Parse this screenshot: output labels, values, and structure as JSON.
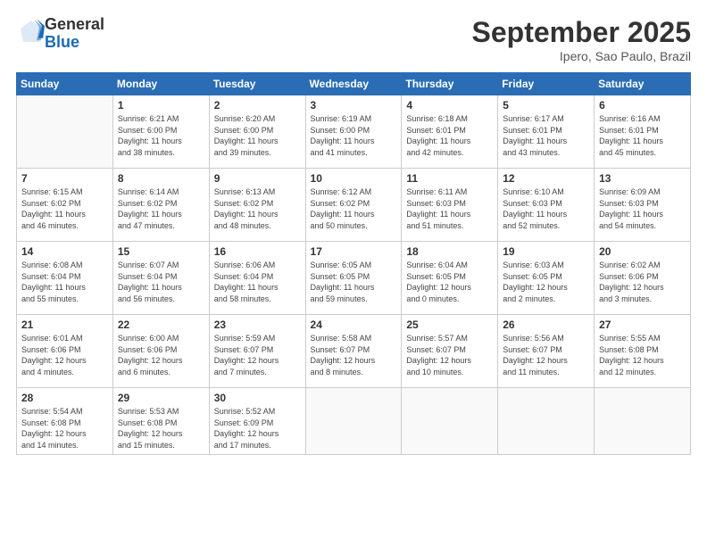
{
  "header": {
    "logo_line1": "General",
    "logo_line2": "Blue",
    "month": "September 2025",
    "location": "Ipero, Sao Paulo, Brazil"
  },
  "days_of_week": [
    "Sunday",
    "Monday",
    "Tuesday",
    "Wednesday",
    "Thursday",
    "Friday",
    "Saturday"
  ],
  "weeks": [
    [
      {
        "day": "",
        "info": ""
      },
      {
        "day": "1",
        "info": "Sunrise: 6:21 AM\nSunset: 6:00 PM\nDaylight: 11 hours\nand 38 minutes."
      },
      {
        "day": "2",
        "info": "Sunrise: 6:20 AM\nSunset: 6:00 PM\nDaylight: 11 hours\nand 39 minutes."
      },
      {
        "day": "3",
        "info": "Sunrise: 6:19 AM\nSunset: 6:00 PM\nDaylight: 11 hours\nand 41 minutes."
      },
      {
        "day": "4",
        "info": "Sunrise: 6:18 AM\nSunset: 6:01 PM\nDaylight: 11 hours\nand 42 minutes."
      },
      {
        "day": "5",
        "info": "Sunrise: 6:17 AM\nSunset: 6:01 PM\nDaylight: 11 hours\nand 43 minutes."
      },
      {
        "day": "6",
        "info": "Sunrise: 6:16 AM\nSunset: 6:01 PM\nDaylight: 11 hours\nand 45 minutes."
      }
    ],
    [
      {
        "day": "7",
        "info": "Sunrise: 6:15 AM\nSunset: 6:02 PM\nDaylight: 11 hours\nand 46 minutes."
      },
      {
        "day": "8",
        "info": "Sunrise: 6:14 AM\nSunset: 6:02 PM\nDaylight: 11 hours\nand 47 minutes."
      },
      {
        "day": "9",
        "info": "Sunrise: 6:13 AM\nSunset: 6:02 PM\nDaylight: 11 hours\nand 48 minutes."
      },
      {
        "day": "10",
        "info": "Sunrise: 6:12 AM\nSunset: 6:02 PM\nDaylight: 11 hours\nand 50 minutes."
      },
      {
        "day": "11",
        "info": "Sunrise: 6:11 AM\nSunset: 6:03 PM\nDaylight: 11 hours\nand 51 minutes."
      },
      {
        "day": "12",
        "info": "Sunrise: 6:10 AM\nSunset: 6:03 PM\nDaylight: 11 hours\nand 52 minutes."
      },
      {
        "day": "13",
        "info": "Sunrise: 6:09 AM\nSunset: 6:03 PM\nDaylight: 11 hours\nand 54 minutes."
      }
    ],
    [
      {
        "day": "14",
        "info": "Sunrise: 6:08 AM\nSunset: 6:04 PM\nDaylight: 11 hours\nand 55 minutes."
      },
      {
        "day": "15",
        "info": "Sunrise: 6:07 AM\nSunset: 6:04 PM\nDaylight: 11 hours\nand 56 minutes."
      },
      {
        "day": "16",
        "info": "Sunrise: 6:06 AM\nSunset: 6:04 PM\nDaylight: 11 hours\nand 58 minutes."
      },
      {
        "day": "17",
        "info": "Sunrise: 6:05 AM\nSunset: 6:05 PM\nDaylight: 11 hours\nand 59 minutes."
      },
      {
        "day": "18",
        "info": "Sunrise: 6:04 AM\nSunset: 6:05 PM\nDaylight: 12 hours\nand 0 minutes."
      },
      {
        "day": "19",
        "info": "Sunrise: 6:03 AM\nSunset: 6:05 PM\nDaylight: 12 hours\nand 2 minutes."
      },
      {
        "day": "20",
        "info": "Sunrise: 6:02 AM\nSunset: 6:06 PM\nDaylight: 12 hours\nand 3 minutes."
      }
    ],
    [
      {
        "day": "21",
        "info": "Sunrise: 6:01 AM\nSunset: 6:06 PM\nDaylight: 12 hours\nand 4 minutes."
      },
      {
        "day": "22",
        "info": "Sunrise: 6:00 AM\nSunset: 6:06 PM\nDaylight: 12 hours\nand 6 minutes."
      },
      {
        "day": "23",
        "info": "Sunrise: 5:59 AM\nSunset: 6:07 PM\nDaylight: 12 hours\nand 7 minutes."
      },
      {
        "day": "24",
        "info": "Sunrise: 5:58 AM\nSunset: 6:07 PM\nDaylight: 12 hours\nand 8 minutes."
      },
      {
        "day": "25",
        "info": "Sunrise: 5:57 AM\nSunset: 6:07 PM\nDaylight: 12 hours\nand 10 minutes."
      },
      {
        "day": "26",
        "info": "Sunrise: 5:56 AM\nSunset: 6:07 PM\nDaylight: 12 hours\nand 11 minutes."
      },
      {
        "day": "27",
        "info": "Sunrise: 5:55 AM\nSunset: 6:08 PM\nDaylight: 12 hours\nand 12 minutes."
      }
    ],
    [
      {
        "day": "28",
        "info": "Sunrise: 5:54 AM\nSunset: 6:08 PM\nDaylight: 12 hours\nand 14 minutes."
      },
      {
        "day": "29",
        "info": "Sunrise: 5:53 AM\nSunset: 6:08 PM\nDaylight: 12 hours\nand 15 minutes."
      },
      {
        "day": "30",
        "info": "Sunrise: 5:52 AM\nSunset: 6:09 PM\nDaylight: 12 hours\nand 17 minutes."
      },
      {
        "day": "",
        "info": ""
      },
      {
        "day": "",
        "info": ""
      },
      {
        "day": "",
        "info": ""
      },
      {
        "day": "",
        "info": ""
      }
    ]
  ]
}
